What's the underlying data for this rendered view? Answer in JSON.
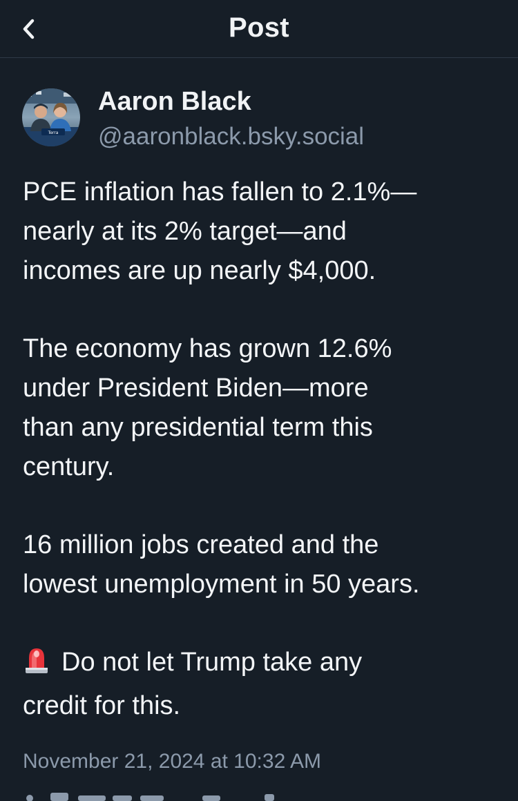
{
  "header": {
    "title": "Post"
  },
  "author": {
    "display_name": "Aaron Black",
    "handle": "@aaronblack.bsky.social",
    "avatar_badge_text": "Terra"
  },
  "post": {
    "paragraphs": [
      {
        "lines": [
          "PCE inflation has fallen to 2.1%—",
          "nearly at its 2% target—and",
          "incomes are up nearly $4,000."
        ]
      },
      {
        "lines": [
          "The economy has grown 12.6%",
          "under President Biden—more",
          "than any presidential term this",
          "century."
        ]
      },
      {
        "lines": [
          "16 million jobs created and the",
          "lowest unemployment in 50 years."
        ]
      },
      {
        "emoji": "rotating-light-icon",
        "lines": [
          "Do not let Trump take any",
          "credit for this."
        ]
      }
    ],
    "timestamp": "November 21, 2024 at 10:32 AM"
  },
  "colors": {
    "background": "#161e27",
    "text": "#f1f3f5",
    "muted": "#8c9aab",
    "divider": "#2e3a48"
  }
}
